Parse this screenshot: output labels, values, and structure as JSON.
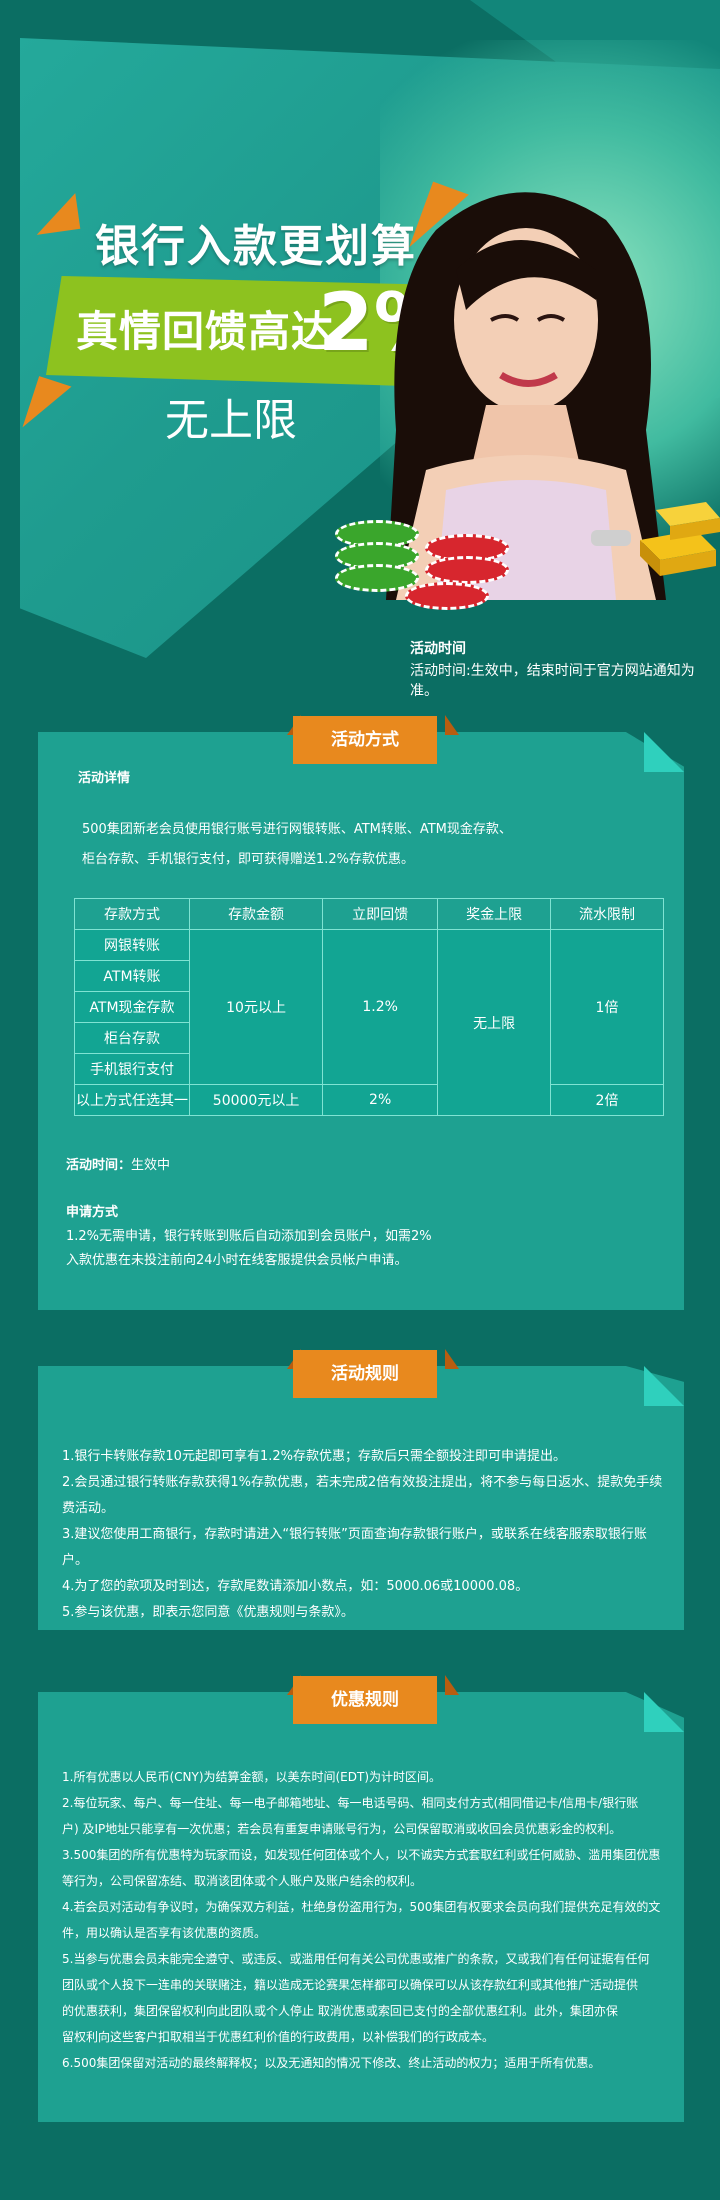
{
  "hero": {
    "line1": "银行入款更划算",
    "line2": "真情回馈高达",
    "percent": "2%",
    "line3": "无上限",
    "event_label": "活动时间",
    "event_text": "活动时间:生效中，结束时间于官方网站通知为准。"
  },
  "section1": {
    "tab": "活动方式",
    "details_title": "活动详情",
    "details_line1": "500集团新老会员使用银行账号进行网银转账、ATM转账、ATM现金存款、",
    "details_line2": "柜台存款、手机银行支付，即可获得赠送1.2%存款优惠。",
    "table": {
      "headers": [
        "存款方式",
        "存款金额",
        "立即回馈",
        "奖金上限",
        "流水限制"
      ],
      "methods": [
        "网银转账",
        "ATM转账",
        "ATM现金存款",
        "柜台存款",
        "手机银行支付",
        "以上方式任选其一"
      ],
      "amount_1": "10元以上",
      "rebate_1": "1.2%",
      "cap": "无上限",
      "turnover_1": "1倍",
      "amount_2": "50000元以上",
      "rebate_2": "2%",
      "turnover_2": "2倍"
    },
    "time_label": "活动时间：",
    "time_value": "生效中",
    "apply_title": "申请方式",
    "apply_line1": "1.2%无需申请，银行转账到账后自动添加到会员账户，如需2%",
    "apply_line2": "入款优惠在未投注前向24小时在线客服提供会员帐户申请。"
  },
  "section2": {
    "tab": "活动规则",
    "rules": [
      "1.银行卡转账存款10元起即可享有1.2%存款优惠；存款后只需全额投注即可申请提出。",
      "2.会员通过银行转账存款获得1%存款优惠，若未完成2倍有效投注提出，将不参与每日返水、提款免手续费活动。",
      "3.建议您使用工商银行，存款时请进入“银行转账”页面查询存款银行账户，或联系在线客服索取银行账户。",
      "4.为了您的款项及时到达，存款尾数请添加小数点，如：5000.06或10000.08。",
      "5.参与该优惠，即表示您同意《优惠规则与条款》。"
    ]
  },
  "section3": {
    "tab": "优惠规则",
    "rules": [
      "1.所有优惠以人民币(CNY)为结算金额，以美东时间(EDT)为计时区间。",
      "2.每位玩家、每户、每一住址、每一电子邮箱地址、每一电话号码、相同支付方式(相同借记卡/信用卡/银行账",
      "户) 及IP地址只能享有一次优惠；若会员有重复申请账号行为，公司保留取消或收回会员优惠彩金的权利。",
      "3.500集团的所有优惠特为玩家而设，如发现任何团体或个人，以不诚实方式套取红利或任何威胁、滥用集团优惠",
      "等行为，公司保留冻结、取消该团体或个人账户及账户结余的权利。",
      "4.若会员对活动有争议时，为确保双方利益，杜绝身份盗用行为，500集团有权要求会员向我们提供充足有效的文",
      "件，用以确认是否享有该优惠的资质。",
      "5.当参与优惠会员未能完全遵守、或违反、或滥用任何有关公司优惠或推广的条款，又或我们有任何证据有任何",
      "团队或个人投下一连串的关联赌注，籍以造成无论赛果怎样都可以确保可以从该存款红利或其他推广活动提供",
      "的优惠获利，集团保留权利向此团队或个人停止 取消优惠或索回已支付的全部优惠红利。此外，集团亦保",
      "留权利向这些客户扣取相当于优惠红利价值的行政费用，以补偿我们的行政成本。",
      "6.500集团保留对活动的最终解释权；以及无通知的情况下修改、终止活动的权力；适用于所有优惠。"
    ]
  }
}
